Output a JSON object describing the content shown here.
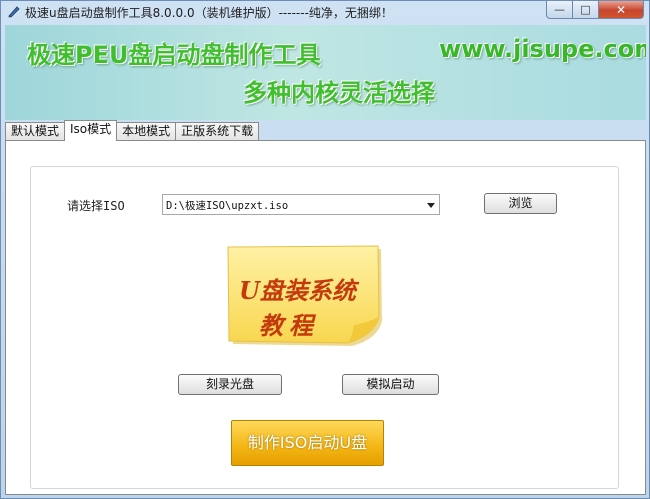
{
  "window": {
    "title": "极速u盘启动盘制作工具8.0.0.0（装机维护版）-------纯净，无捆绑！",
    "minimize_glyph": "—",
    "maximize_glyph": "□",
    "close_glyph": "✕"
  },
  "banner": {
    "title": "极速PEU盘启动盘制作工具",
    "url": "www.jisupe.com",
    "subtitle": "多种内核灵活选择"
  },
  "tabs": [
    {
      "label": "默认模式",
      "active": false
    },
    {
      "label": "Iso模式",
      "active": true
    },
    {
      "label": "本地模式",
      "active": false
    },
    {
      "label": "正版系统下载",
      "active": false
    }
  ],
  "iso": {
    "label": "请选择ISO",
    "selected_path": "D:\\极速ISO\\upzxt.iso",
    "browse_label": "浏览"
  },
  "note_image": {
    "line1": "U盘装系统",
    "line2": "教程",
    "color": "#c43a0d",
    "background": "#fbe57a"
  },
  "actions": {
    "burn_label": "刻录光盘",
    "simulate_label": "模拟启动",
    "make_label": "制作ISO启动U盘"
  }
}
